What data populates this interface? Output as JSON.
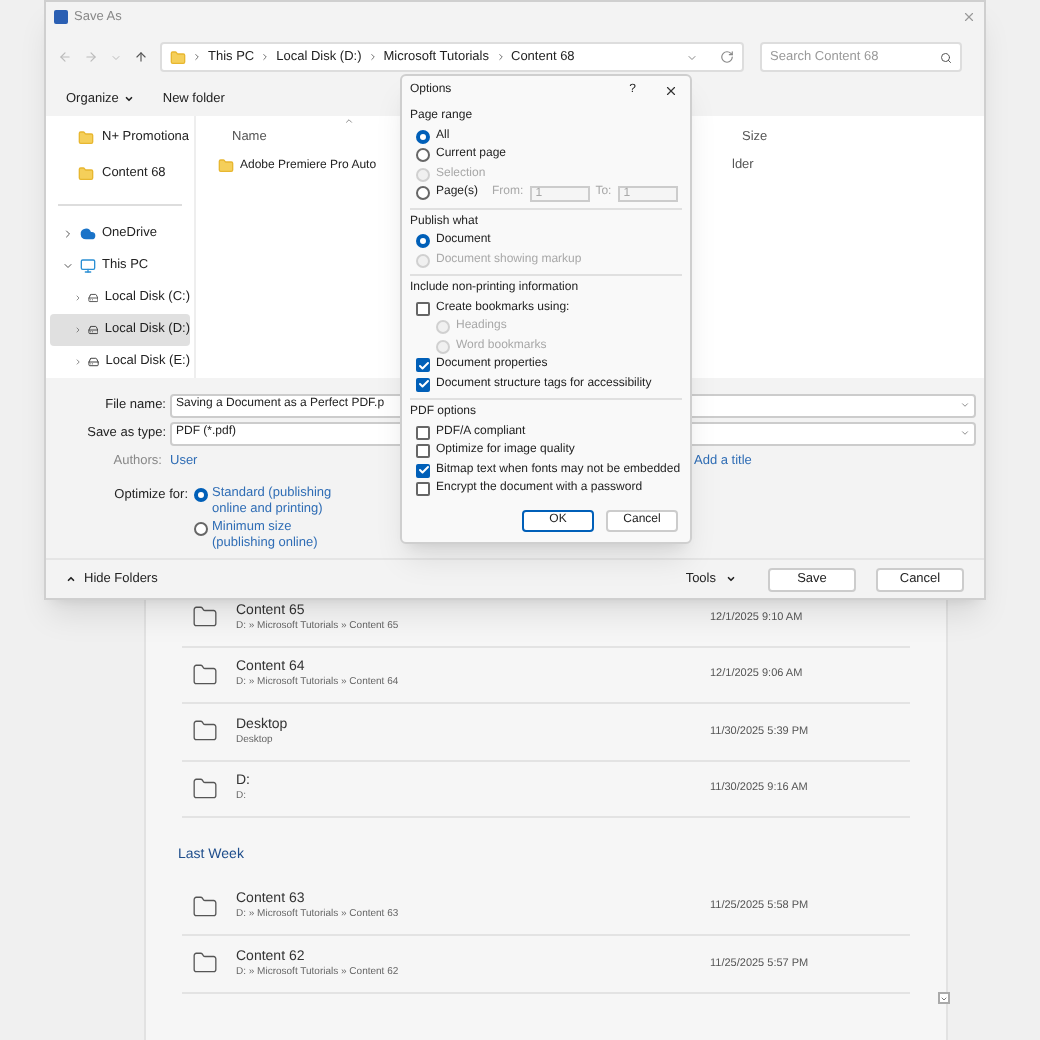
{
  "recent": {
    "groups": [
      {
        "items": [
          {
            "name": "Content 65",
            "path": "D: » Microsoft Tutorials » Content 65",
            "date": "12/1/2025 9:10 AM"
          },
          {
            "name": "Content 64",
            "path": "D: » Microsoft Tutorials » Content 64",
            "date": "12/1/2025 9:06 AM"
          },
          {
            "name": "Desktop",
            "path": "Desktop",
            "date": "11/30/2025 5:39 PM"
          },
          {
            "name": "D:",
            "path": "D:",
            "date": "11/30/2025 9:16 AM"
          }
        ]
      },
      {
        "title": "Last Week",
        "items": [
          {
            "name": "Content 63",
            "path": "D: » Microsoft Tutorials » Content 63",
            "date": "11/25/2025 5:58 PM"
          },
          {
            "name": "Content 62",
            "path": "D: » Microsoft Tutorials » Content 62",
            "date": "11/25/2025 5:57 PM"
          }
        ]
      }
    ]
  },
  "save_as": {
    "title": "Save As",
    "breadcrumb": [
      "This PC",
      "Local Disk (D:)",
      "Microsoft Tutorials",
      "Content 68"
    ],
    "search": {
      "placeholder": "Search Content 68"
    },
    "toolbar": [
      {
        "label": "Organize",
        "dropdown": true
      },
      {
        "label": "New folder",
        "dropdown": false
      }
    ],
    "pinned": [
      {
        "label": "N+ Promotiona"
      },
      {
        "label": "Content 68"
      }
    ],
    "tree": [
      {
        "label": "OneDrive",
        "kind": "cloud",
        "expanded": false,
        "selected": false
      },
      {
        "label": "This PC",
        "kind": "pc",
        "expanded": true,
        "selected": false,
        "children": [
          {
            "label": "Local Disk (C:)",
            "kind": "system-drive",
            "expanded": false,
            "selected": false
          },
          {
            "label": "Local Disk (D:)",
            "kind": "drive",
            "expanded": false,
            "selected": true
          },
          {
            "label": "Local Disk (E:)",
            "kind": "drive",
            "expanded": false,
            "selected": false
          }
        ]
      }
    ],
    "columns": [
      {
        "label": "Name",
        "sorted": true
      },
      {
        "label": "Size",
        "sorted": false
      }
    ],
    "files": [
      {
        "name": "Adobe Premiere Pro Auto",
        "type": "lder"
      }
    ],
    "file_name": {
      "label": "File name:",
      "value": "Saving a Document as a Perfect PDF.p"
    },
    "save_as_type": {
      "label": "Save as type:",
      "value": "PDF (*.pdf)"
    },
    "authors": {
      "label": "Authors:",
      "value": "User"
    },
    "title_value": "Add a title",
    "optimize": {
      "label": "Optimize for:",
      "options": [
        {
          "label": "Standard (publishing online and printing)",
          "selected": true
        },
        {
          "label": "Minimum size (publishing online)",
          "selected": false
        }
      ]
    },
    "hide_folders": "Hide Folders",
    "tools": "Tools",
    "buttons": [
      "Save",
      "Cancel"
    ]
  },
  "options_dialog": {
    "title": "Options",
    "help": "?",
    "sections": [
      {
        "title": "Page range",
        "items": [
          {
            "kind": "radio",
            "label": "All",
            "selected": true,
            "disabled": false
          },
          {
            "kind": "radio",
            "label": "Current page",
            "selected": false,
            "disabled": false
          },
          {
            "kind": "radio",
            "label": "Selection",
            "selected": false,
            "disabled": true
          },
          {
            "kind": "pages",
            "label": "Page(s)",
            "selected": false,
            "disabled": false,
            "from_label": "From:",
            "from": "1",
            "to_label": "To:",
            "to": "1"
          }
        ]
      },
      {
        "title": "Publish what",
        "items": [
          {
            "kind": "radio",
            "label": "Document",
            "selected": true,
            "disabled": false
          },
          {
            "kind": "radio",
            "label": "Document showing markup",
            "selected": false,
            "disabled": true
          }
        ]
      },
      {
        "title": "Include non-printing information",
        "items": [
          {
            "kind": "checkbox",
            "label": "Create bookmarks using:",
            "checked": false,
            "disabled": false,
            "children": [
              {
                "kind": "radio",
                "label": "Headings",
                "selected": false,
                "disabled": true
              },
              {
                "kind": "radio",
                "label": "Word bookmarks",
                "selected": false,
                "disabled": true
              }
            ]
          },
          {
            "kind": "checkbox",
            "label": "Document properties",
            "checked": true,
            "disabled": false
          },
          {
            "kind": "checkbox",
            "label": "Document structure tags for accessibility",
            "checked": true,
            "disabled": false
          }
        ]
      },
      {
        "title": "PDF options",
        "items": [
          {
            "kind": "checkbox",
            "label": "PDF/A compliant",
            "checked": false,
            "disabled": false
          },
          {
            "kind": "checkbox",
            "label": "Optimize for image quality",
            "checked": false,
            "disabled": false
          },
          {
            "kind": "checkbox",
            "label": "Bitmap text when fonts may not be embedded",
            "checked": true,
            "disabled": false
          },
          {
            "kind": "checkbox",
            "label": "Encrypt the document with a password",
            "checked": false,
            "disabled": false
          }
        ]
      }
    ],
    "buttons": [
      {
        "label": "OK",
        "default": true
      },
      {
        "label": "Cancel",
        "default": false
      }
    ]
  }
}
